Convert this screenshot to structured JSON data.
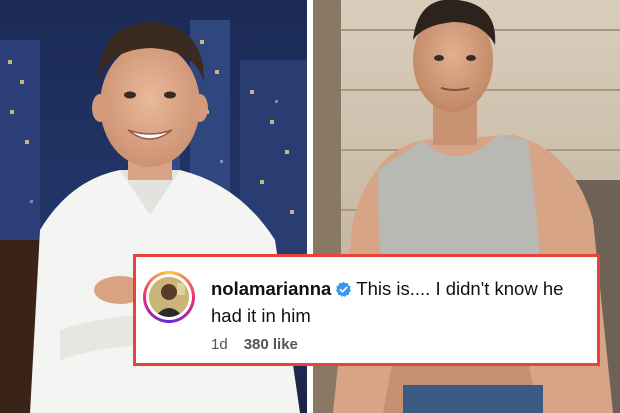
{
  "comment": {
    "username": "nolamarianna",
    "verified_icon": "verified-badge-icon",
    "text": "This is.... I didn't know he had it in him",
    "time": "1d",
    "likes": "380 like"
  },
  "colors": {
    "card_border": "#e8433a",
    "verified_blue": "#3897f0",
    "avatar_ring": [
      "#f9ce34",
      "#ee2a7b",
      "#6228d7"
    ]
  }
}
